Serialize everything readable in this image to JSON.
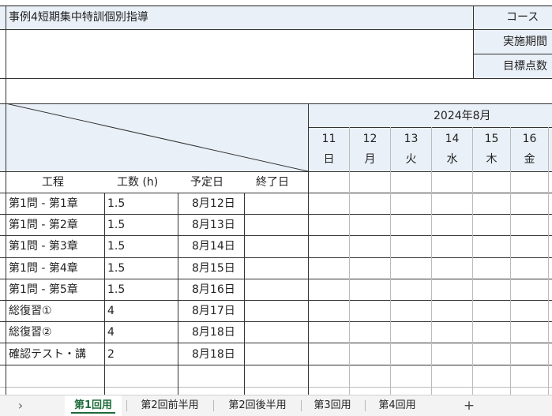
{
  "header": {
    "title": "事例4短期集中特訓個別指導",
    "course_label": "コース",
    "period_label": "実施期間",
    "target_label": "目標点数"
  },
  "calendar": {
    "month_label": "2024年8月",
    "days": [
      {
        "date": "11",
        "weekday": "日"
      },
      {
        "date": "12",
        "weekday": "月"
      },
      {
        "date": "13",
        "weekday": "火"
      },
      {
        "date": "14",
        "weekday": "水"
      },
      {
        "date": "15",
        "weekday": "木"
      },
      {
        "date": "16",
        "weekday": "金"
      }
    ]
  },
  "table": {
    "columns": [
      "工程",
      "工数 (h)",
      "予定日",
      "終了日"
    ],
    "rows": [
      {
        "process": "第1問 - 第1章",
        "hours": "1.5",
        "planned": "8月12日",
        "done": ""
      },
      {
        "process": "第1問 - 第2章",
        "hours": "1.5",
        "planned": "8月13日",
        "done": ""
      },
      {
        "process": "第1問 - 第3章",
        "hours": "1.5",
        "planned": "8月14日",
        "done": ""
      },
      {
        "process": "第1問 - 第4章",
        "hours": "1.5",
        "planned": "8月15日",
        "done": ""
      },
      {
        "process": "第1問 - 第5章",
        "hours": "1.5",
        "planned": "8月16日",
        "done": ""
      },
      {
        "process": "総復習①",
        "hours": "4",
        "planned": "8月17日",
        "done": ""
      },
      {
        "process": "総復習②",
        "hours": "4",
        "planned": "8月18日",
        "done": ""
      },
      {
        "process": "確認テスト・講",
        "hours": "2",
        "planned": "8月18日",
        "done": ""
      }
    ]
  },
  "tabs": {
    "nav_label": "›",
    "items": [
      "第1回用",
      "第2回前半用",
      "第2回後半用",
      "第3回用",
      "第4回用"
    ],
    "active": "第1回用",
    "add_label": "+"
  }
}
